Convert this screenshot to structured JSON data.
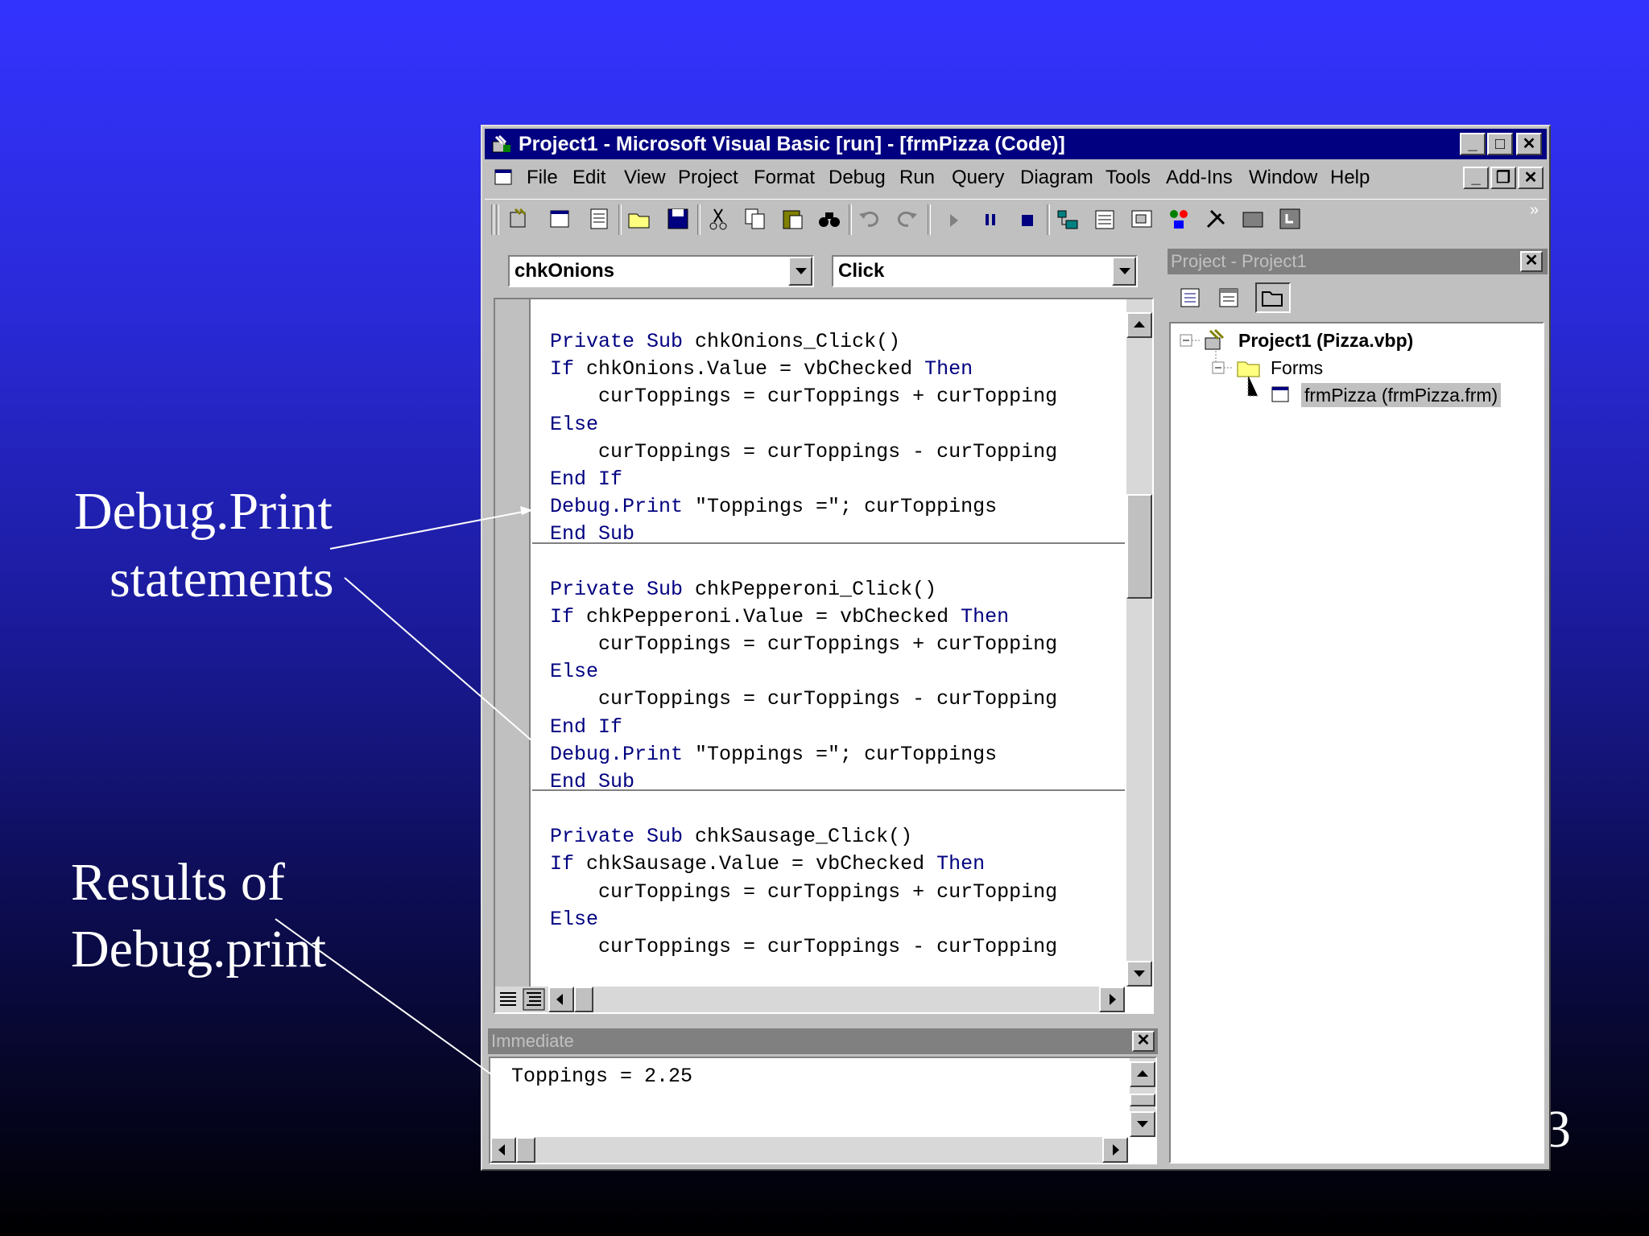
{
  "slide": {
    "left_label_1_line1": "Debug.Print",
    "left_label_1_line2": "statements",
    "left_label_2_line1": "Results of",
    "left_label_2_line2": "Debug.print",
    "page_number": "3"
  },
  "window": {
    "title": "Project1 - Microsoft Visual Basic [run] - [frmPizza (Code)]"
  },
  "menu": [
    "File",
    "Edit",
    "View",
    "Project",
    "Format",
    "Debug",
    "Run",
    "Query",
    "Diagram",
    "Tools",
    "Add-Ins",
    "Window",
    "Help"
  ],
  "code_window": {
    "object_combo": "chkOnions",
    "procedure_combo": "Click",
    "procedures": [
      {
        "lines": [
          [
            "Private Sub ",
            "chkOnions_Click()"
          ],
          [
            "If ",
            "chkOnions.Value = vbChecked ",
            "Then"
          ],
          [
            "",
            "    curToppings = curToppings + curTopping"
          ],
          [
            "Else",
            ""
          ],
          [
            "",
            "    curToppings = curToppings - curTopping"
          ],
          [
            "End If",
            ""
          ],
          [
            "Debug.Print ",
            "\"Toppings =\"; curToppings"
          ],
          [
            "End Sub",
            ""
          ]
        ]
      },
      {
        "lines": [
          [
            "Private Sub ",
            "chkPepperoni_Click()"
          ],
          [
            "If ",
            "chkPepperoni.Value = vbChecked ",
            "Then"
          ],
          [
            "",
            "    curToppings = curToppings + curTopping"
          ],
          [
            "Else",
            ""
          ],
          [
            "",
            "    curToppings = curToppings - curTopping"
          ],
          [
            "End If",
            ""
          ],
          [
            "Debug.Print ",
            "\"Toppings =\"; curToppings"
          ],
          [
            "End Sub",
            ""
          ]
        ]
      },
      {
        "lines": [
          [
            "Private Sub ",
            "chkSausage_Click()"
          ],
          [
            "If ",
            "chkSausage.Value = vbChecked ",
            "Then"
          ],
          [
            "",
            "    curToppings = curToppings + curTopping"
          ],
          [
            "Else",
            ""
          ],
          [
            "",
            "    curToppings = curToppings - curTopping"
          ]
        ]
      }
    ]
  },
  "immediate": {
    "title": "Immediate",
    "output": "Toppings = 2.25"
  },
  "project_explorer": {
    "title": "Project - Project1",
    "project": "Project1 (Pizza.vbp)",
    "folder": "Forms",
    "form": "frmPizza (frmPizza.frm)"
  }
}
